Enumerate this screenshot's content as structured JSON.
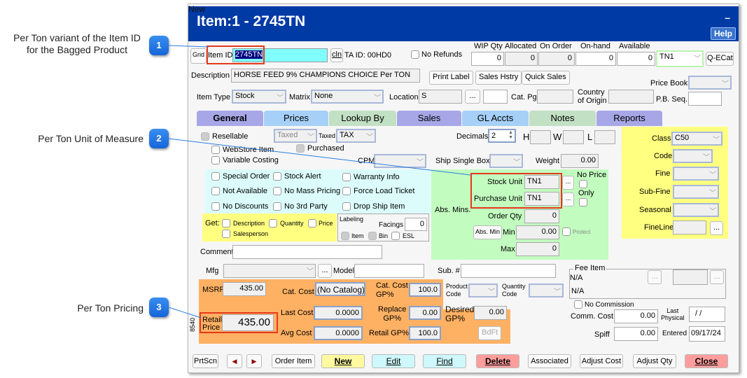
{
  "callouts": [
    {
      "number": "1",
      "text_line1": "Per Ton variant of the Item ID",
      "text_line2": "for the Bagged Product"
    },
    {
      "number": "2",
      "text": "Per Ton Unit of Measure"
    },
    {
      "number": "3",
      "text": "Per Ton Pricing"
    }
  ],
  "window": {
    "new_label": "New",
    "title": "Item:1 - 2745TN",
    "help_label": "Help",
    "minimize_label": "–"
  },
  "header": {
    "grid_label": "Grid",
    "item_id_label": "Item ID",
    "item_id_value": "2745TN",
    "cln_label": "cln",
    "ta_id": "TA ID: 00HD0",
    "no_refunds": "No Refunds",
    "qty_headers": [
      "WIP Qty",
      "Allocated",
      "On Order",
      "On-hand",
      "Available"
    ],
    "qty_values": [
      "0",
      "0",
      "0",
      "0",
      "0"
    ],
    "unit_select": "TN1",
    "qecat_label": "Q-ECat",
    "description_label": "Description",
    "description_value": "HORSE FEED 9% CHAMPIONS CHOICE Per TON",
    "print_label": "Print Label",
    "sales_history": "Sales Hstry",
    "quick_sales": "Quick Sales",
    "price_book_label": "Price Book",
    "item_type_label": "Item Type",
    "item_type_value": "Stock",
    "matrix_label": "Matrix",
    "matrix_value": "None",
    "location_label": "Location",
    "location_value": "S",
    "ellipsis": "...",
    "cat_pg_label": "Cat. Pg.",
    "country_label_1": "Country",
    "country_label_2": "of Origin",
    "pb_seq_label": "P.B. Seq."
  },
  "tabs": [
    {
      "label": "General",
      "color": "#a7a7e8"
    },
    {
      "label": "Prices",
      "color": "#a6d0f7"
    },
    {
      "label": "Lookup By",
      "color": "#c2e0c4"
    },
    {
      "label": "Sales",
      "color": "#a7a7e8"
    },
    {
      "label": "GL Accts",
      "color": "#a6d0f7"
    },
    {
      "label": "Notes",
      "color": "#c2e0c4"
    },
    {
      "label": "Reports",
      "color": "#a7a7e8"
    }
  ],
  "general": {
    "resellable": "Resellable",
    "taxed_select": "Taxed",
    "taxed_label": "Taxed",
    "tax_select": "TAX",
    "webstore": "WebStore Item",
    "purchased": "Purchased",
    "variable_costing": "Variable Costing",
    "cpm_label": "CPM",
    "decimals_label": "Decimals",
    "decimals_value": "2",
    "h_label": "H",
    "w_label": "W",
    "l_label": "L",
    "ship_single_box": "Ship Single Box",
    "weight_label": "Weight",
    "weight_value": "0.00",
    "checks": [
      "Special Order",
      "Stock Alert",
      "Warranty Info",
      "Not Available",
      "No Mass Pricing",
      "Force Load Ticket",
      "No Discounts",
      "No 3rd Party",
      "Drop Ship Item"
    ],
    "get_label": "Get:",
    "get_items": [
      "Description",
      "Quantity",
      "Price",
      "Salesperson"
    ],
    "labeling_label": "Labeling",
    "facings_label": "Facings",
    "facings_value": "0",
    "label_items": [
      "Item",
      "Bin",
      "ESL"
    ],
    "stock_unit_label": "Stock Unit",
    "stock_unit_value": "TN1",
    "purchase_unit_label": "Purchase Unit",
    "purchase_unit_value": "TN1",
    "no_price_label": "No Price",
    "only_label": "Only",
    "abs_mins_label": "Abs. Mins.",
    "order_qty_label": "Order Qty",
    "order_qty_value": "0",
    "abs_min_button": "Abs. Min",
    "min_label": "Min",
    "min_value": "0.00",
    "protect_label": "Protect",
    "max_label": "Max",
    "max_value": "0",
    "class_label": "Class",
    "class_value": "C50",
    "code_label": "Code",
    "fine_label": "Fine",
    "subfine_label": "Sub-Fine",
    "seasonal_label": "Seasonal",
    "fineline_label": "FineLine",
    "comment_label": "Comment",
    "mfg_label": "Mfg",
    "model_label": "Model",
    "sub_label": "Sub. #",
    "msrp_label": "MSRP",
    "msrp_value": "435.00",
    "cat_cost_label": "Cat. Cost",
    "cat_cost_value": "(No Catalog)",
    "cat_cost_gp_label_1": "Cat. Cost",
    "cat_cost_gp_label_2": "GP%",
    "cat_cost_gp_value": "100.0",
    "product_code_1": "Product",
    "product_code_2": "Code",
    "quantity_code_1": "Quantity",
    "quantity_code_2": "Code",
    "retail_price_label_1": "Retail",
    "retail_price_label_2": "Price",
    "retail_price_value": "435.00",
    "last_cost_label": "Last Cost",
    "last_cost_value": "0.0000",
    "replace_gp_1": "Replace",
    "replace_gp_2": "GP%",
    "replace_gp_value": "0.00",
    "desired_gp_1": "Desired",
    "desired_gp_2": "GP%",
    "desired_gp_value": "0.00",
    "avg_cost_label": "Avg Cost",
    "avg_cost_value": "0.0000",
    "retail_gp_label": "Retail GP%",
    "retail_gp_value": "100.0",
    "bdft_label": "BdFt",
    "side_code": "8540",
    "fee_item_label": "Fee Item",
    "fee_na1": "N/A",
    "fee_na2": "N/A",
    "no_commission": "No Commission",
    "comm_cost_label": "Comm. Cost",
    "comm_cost_value": "0.00",
    "last_physical_1": "Last",
    "last_physical_2": "Physical",
    "last_physical_value": " /  /",
    "spiff_label": "Spiff",
    "spiff_value": "0.00",
    "entered_label": "Entered",
    "entered_value": "09/17/24"
  },
  "footer": {
    "prtscn": "PrtScn",
    "prev": "◀",
    "next": "▶",
    "order_item": "Order Item",
    "new": "New",
    "edit": "Edit",
    "find": "Find",
    "delete": "Delete",
    "associated": "Associated",
    "adjust_cost": "Adjust Cost",
    "adjust_qty": "Adjust Qty",
    "close": "Close"
  }
}
